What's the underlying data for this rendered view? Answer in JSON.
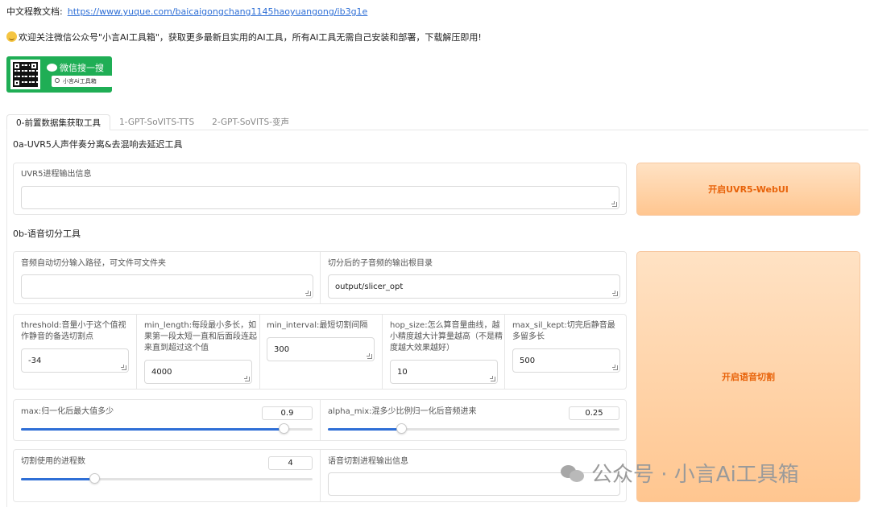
{
  "header": {
    "doc_label": "中文程教文档:",
    "doc_link": "https://www.yuque.com/baicaigongchang1145haoyuangong/ib3g1e",
    "welcome": "欢迎关注微信公众号\"小言AI工具箱\"，获取更多最新且实用的AI工具，所有AI工具无需自己安装和部署，下载解压即用!"
  },
  "wechat_card": {
    "title": "微信搜一搜",
    "search_text": "小言Ai工具箱",
    "color": "#1fae55"
  },
  "tabs": [
    {
      "label": "0-前置数据集获取工具",
      "active": true
    },
    {
      "label": "1-GPT-SoVITS-TTS",
      "active": false
    },
    {
      "label": "2-GPT-SoVITS-变声",
      "active": false
    }
  ],
  "uvr5": {
    "section_title": "0a-UVR5人声伴奏分离&去混响去延迟工具",
    "output_label": "UVR5进程输出信息",
    "output_value": "",
    "button_label": "开启UVR5-WebUI"
  },
  "slicer": {
    "section_title": "0b-语音切分工具",
    "input_path_label": "音频自动切分输入路径，可文件可文件夹",
    "input_path_value": "",
    "output_dir_label": "切分后的子音频的输出根目录",
    "output_dir_value": "output/slicer_opt",
    "params": [
      {
        "label": "threshold:音量小于这个值视作静音的备选切割点",
        "value": "-34"
      },
      {
        "label": "min_length:每段最小多长，如果第一段太短一直和后面段连起来直到超过这个值",
        "value": "4000"
      },
      {
        "label": "min_interval:最短切割间隔",
        "value": "300"
      },
      {
        "label": "hop_size:怎么算音量曲线，越小精度越大计算量越高（不是精度越大效果越好）",
        "value": "10"
      },
      {
        "label": "max_sil_kept:切完后静音最多留多长",
        "value": "500"
      }
    ],
    "max_label": "max:归一化后最大值多少",
    "max_value": "0.9",
    "max_fraction": 0.9,
    "alpha_label": "alpha_mix:混多少比例归一化后音频进来",
    "alpha_value": "0.25",
    "alpha_fraction": 0.25,
    "procs_label": "切割使用的进程数",
    "procs_value": "4",
    "procs_fraction": 0.25,
    "log_label": "语音切割进程输出信息",
    "log_value": "",
    "button_label": "开启语音切割"
  },
  "watermark": "公众号 · 小言Ai工具箱",
  "colors": {
    "accent": "#2f6fd6",
    "button_text": "#e8630a",
    "button_bg": "#ffc690"
  }
}
